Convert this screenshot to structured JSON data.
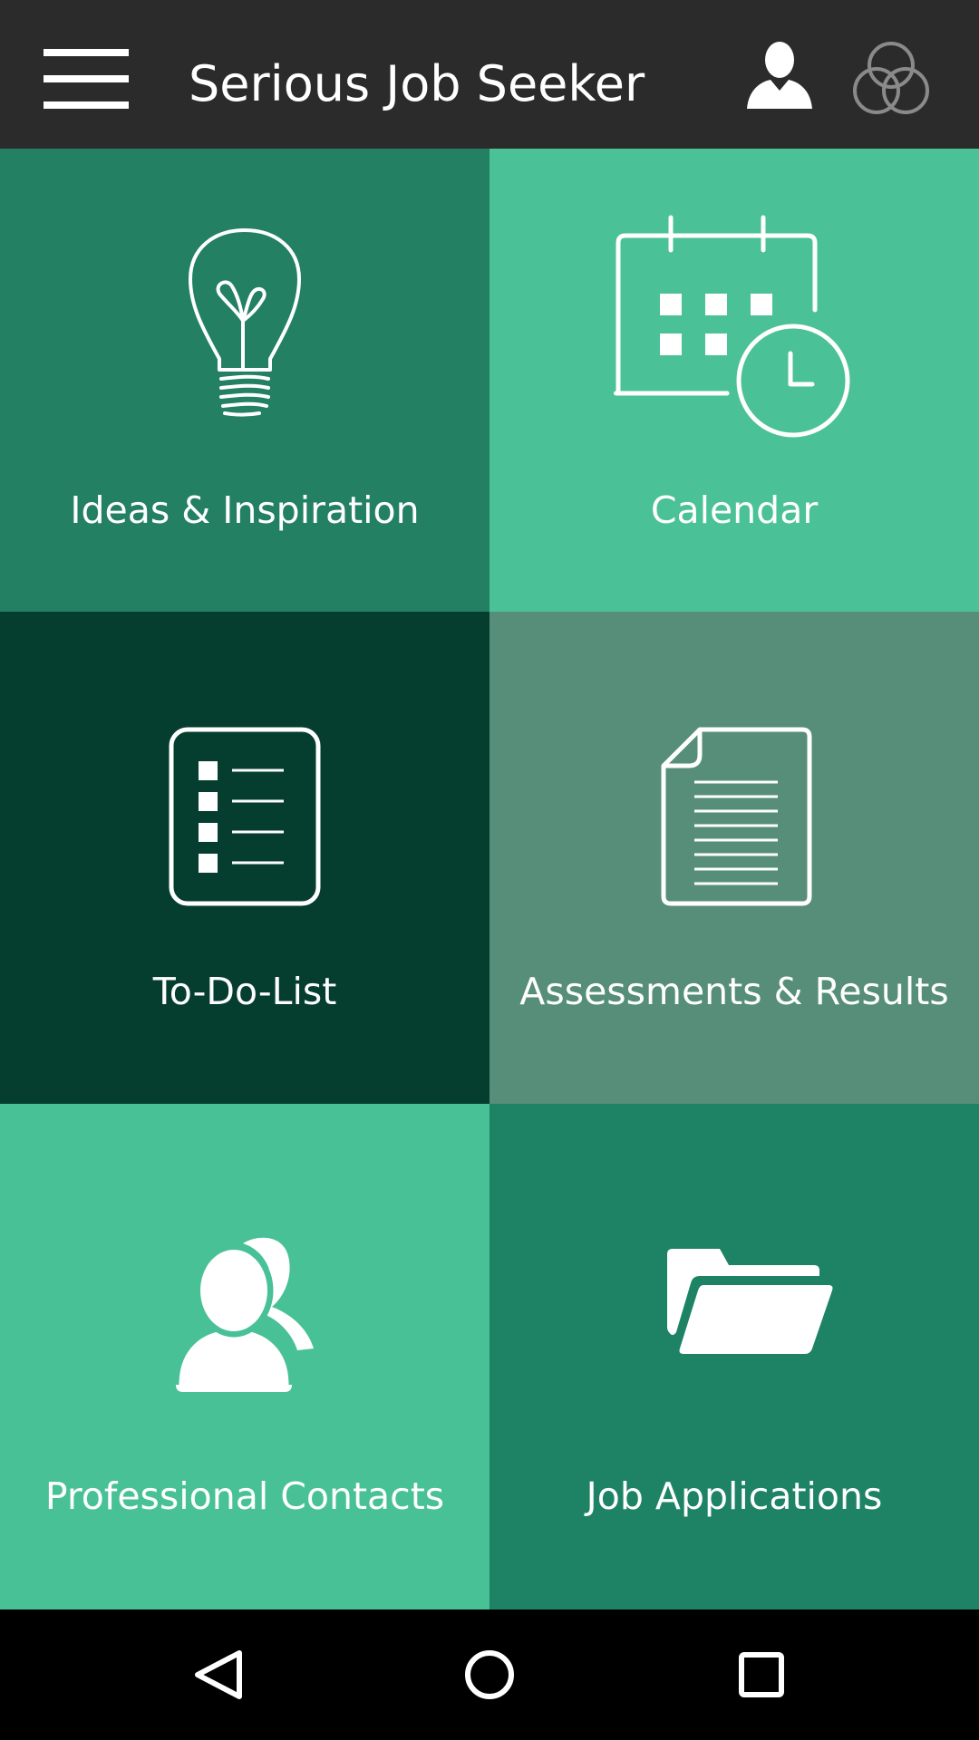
{
  "header": {
    "title": "Serious Job Seeker",
    "menu_icon": "hamburger-menu-icon",
    "profile_icon": "user-profile-icon",
    "logo_icon": "overlapping-circles-logo-icon",
    "background": "#2b2b2b"
  },
  "tiles": [
    {
      "label": "Ideas & Inspiration",
      "icon": "lightbulb-icon",
      "color": "#238063"
    },
    {
      "label": "Calendar",
      "icon": "calendar-clock-icon",
      "color": "#4ac196"
    },
    {
      "label": "To-Do-List",
      "icon": "checklist-icon",
      "color": "#053e2e"
    },
    {
      "label": "Assessments & Results",
      "icon": "document-icon",
      "color": "#568e7a"
    },
    {
      "label": "Professional Contacts",
      "icon": "contacts-icon",
      "color": "#48c197"
    },
    {
      "label": "Job Applications",
      "icon": "folder-icon",
      "color": "#1e8364"
    }
  ],
  "navigation": {
    "back_icon": "back-triangle-icon",
    "home_icon": "home-circle-icon",
    "recents_icon": "recents-square-icon"
  }
}
